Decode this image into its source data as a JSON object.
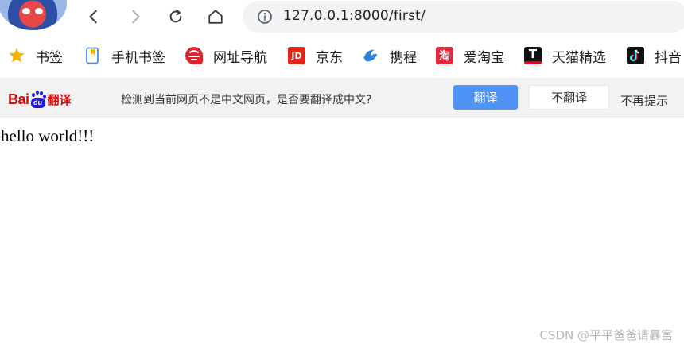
{
  "browser": {
    "back_icon": "chevron-left-icon",
    "forward_icon": "chevron-right-icon",
    "reload_icon": "reload-icon",
    "home_icon": "home-icon",
    "site_info_icon": "info-circle-icon",
    "url": "127.0.0.1:8000/first/"
  },
  "bookmarks": [
    {
      "label": "书签",
      "icon": "star-icon",
      "color": "#f5b400"
    },
    {
      "label": "手机书签",
      "icon": "phone-bookmark-icon",
      "color": "#4a90e2"
    },
    {
      "label": "网址导航",
      "icon": "site-nav-icon",
      "color": "#e0242b"
    },
    {
      "label": "京东",
      "icon": "jd-icon",
      "icon_text": "JD",
      "color": "#e1251b"
    },
    {
      "label": "携程",
      "icon": "ctrip-icon",
      "color": "#2b7fe0"
    },
    {
      "label": "爱淘宝",
      "icon": "taobao-icon",
      "icon_text": "淘",
      "color": "#e3273c"
    },
    {
      "label": "天猫精选",
      "icon": "tmall-icon",
      "icon_text": "T",
      "color": "#e1001e"
    },
    {
      "label": "抖音",
      "icon": "douyin-icon",
      "color": "#111111"
    }
  ],
  "translate_bar": {
    "logo_text_bai": "Bai",
    "logo_text_du": "du",
    "logo_text_fanyi": "翻译",
    "message": "检测到当前网页不是中文网页，是否要翻译成中文?",
    "translate_label": "翻译",
    "dont_translate_label": "不翻译",
    "never_label": "不再提示",
    "accent": "#4e93f5"
  },
  "page": {
    "body_text": "hello world!!!",
    "watermark": "CSDN @平平爸爸请暴富"
  }
}
